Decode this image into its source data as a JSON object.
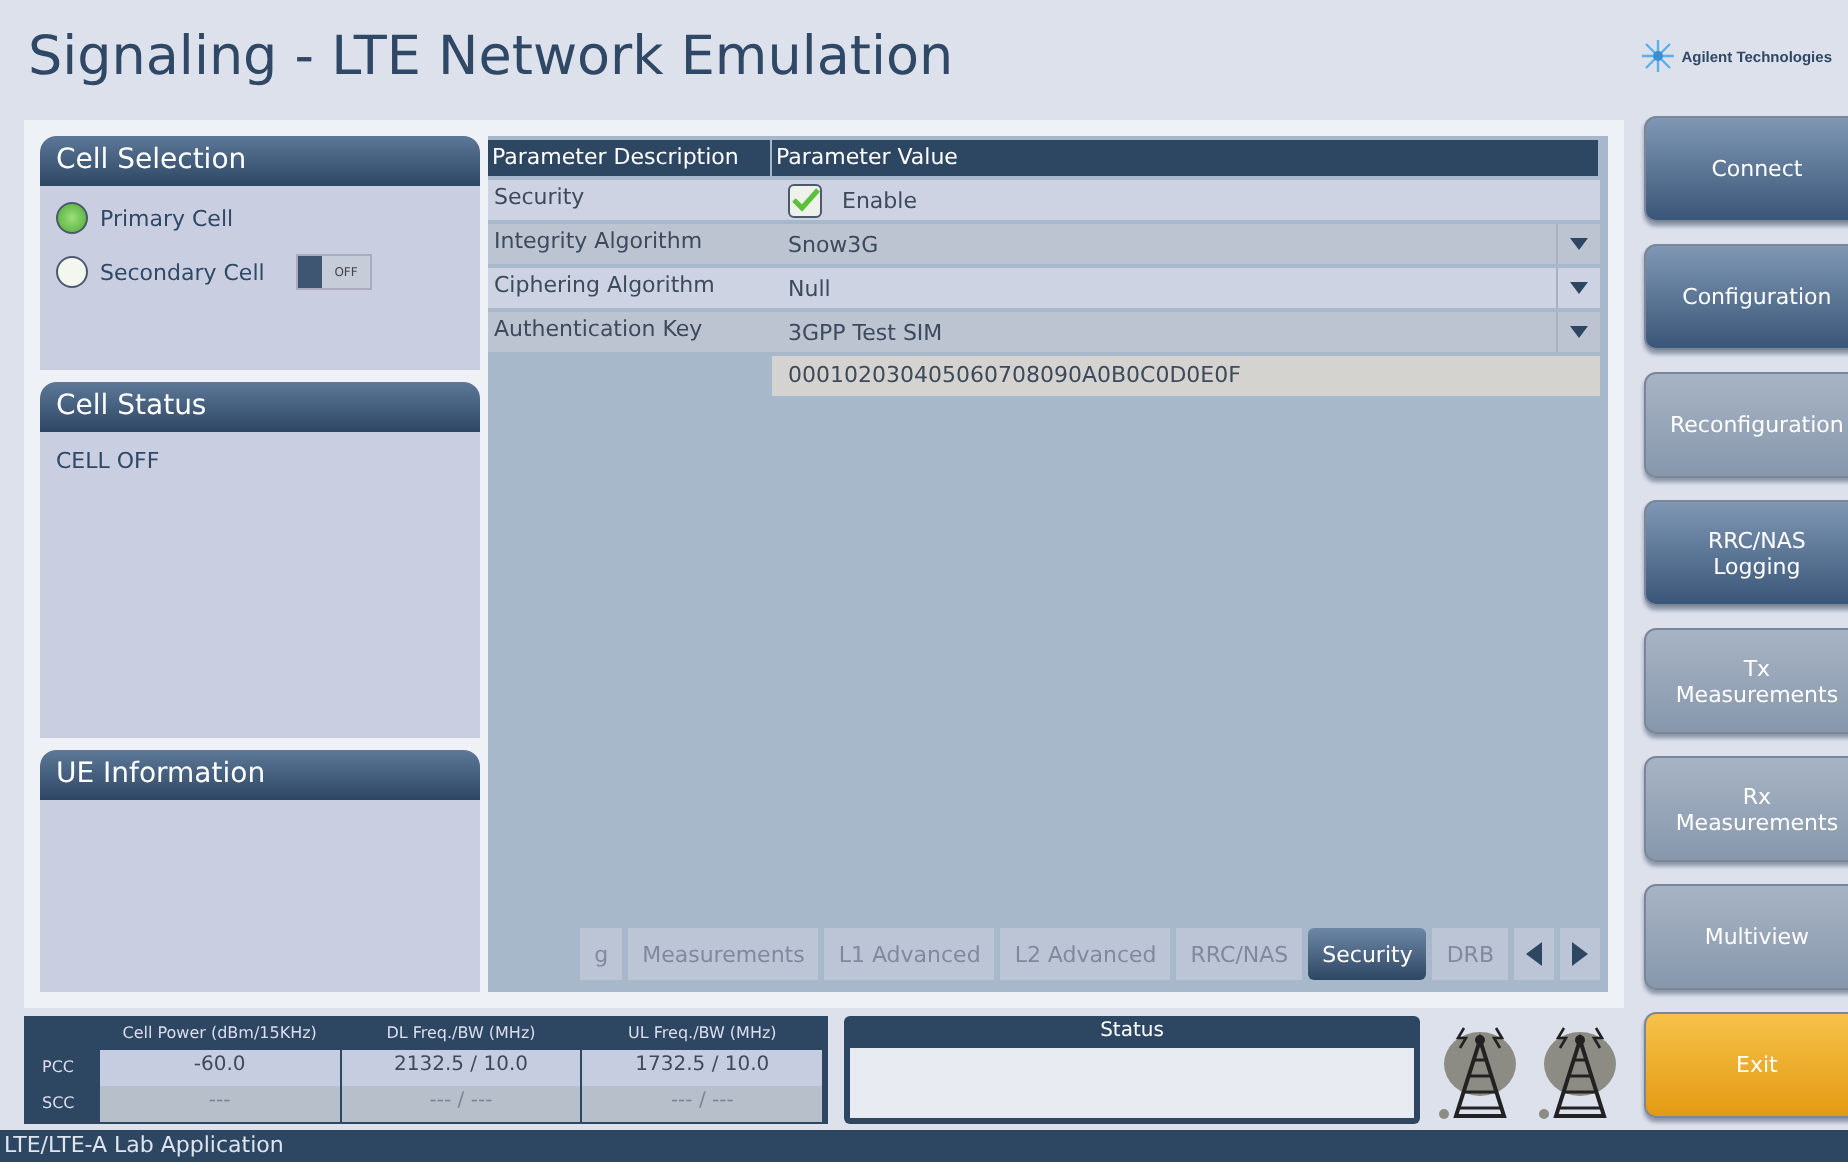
{
  "title": "Signaling - LTE Network Emulation",
  "logo": {
    "text": "Agilent Technologies"
  },
  "cell_selection": {
    "title": "Cell Selection",
    "options": [
      {
        "label": "Primary Cell",
        "selected": true
      },
      {
        "label": "Secondary Cell",
        "selected": false
      }
    ],
    "secondary_toggle": {
      "label": "OFF",
      "on": false
    }
  },
  "cell_status": {
    "title": "Cell Status",
    "text": "CELL OFF"
  },
  "ue_information": {
    "title": "UE Information"
  },
  "parameters": {
    "columns": [
      "Parameter Description",
      "Parameter Value"
    ],
    "rows": [
      {
        "kind": "checkbox",
        "label": "Security",
        "value": "Enable",
        "checked": true
      },
      {
        "kind": "dropdown",
        "label": "Integrity Algorithm",
        "value": "Snow3G"
      },
      {
        "kind": "dropdown",
        "label": "Ciphering Algorithm",
        "value": "Null"
      },
      {
        "kind": "dropdown",
        "label": "Authentication Key",
        "value": "3GPP Test SIM"
      },
      {
        "kind": "text",
        "label": "",
        "value": "000102030405060708090A0B0C0D0E0F"
      }
    ]
  },
  "tabs": [
    {
      "label": "g",
      "selected": false
    },
    {
      "label": "Measurements",
      "selected": false
    },
    {
      "label": "L1 Advanced",
      "selected": false
    },
    {
      "label": "L2 Advanced",
      "selected": false
    },
    {
      "label": "RRC/NAS",
      "selected": false
    },
    {
      "label": "Security",
      "selected": true
    },
    {
      "label": "DRB",
      "selected": false
    }
  ],
  "power_table": {
    "columns": [
      "Cell Power (dBm/15KHz)",
      "DL Freq./BW (MHz)",
      "UL Freq./BW (MHz)"
    ],
    "rows": [
      {
        "label": "PCC",
        "cells": [
          "-60.0",
          "2132.5 / 10.0",
          "1732.5 / 10.0"
        ]
      },
      {
        "label": "SCC",
        "cells": [
          "---",
          "--- / ---",
          "--- / ---"
        ]
      }
    ]
  },
  "status": {
    "title": "Status"
  },
  "buttons": [
    {
      "kind": "normal",
      "label": "Connect",
      "disabled": false
    },
    {
      "kind": "normal",
      "label": "Configuration",
      "disabled": false
    },
    {
      "kind": "normal",
      "label": "Reconfiguration",
      "disabled": true
    },
    {
      "kind": "normal",
      "label": "RRC/NAS Logging",
      "disabled": false
    },
    {
      "kind": "normal",
      "label": "Tx Measurements",
      "disabled": true
    },
    {
      "kind": "normal",
      "label": "Rx Measurements",
      "disabled": true
    },
    {
      "kind": "normal",
      "label": "Multiview",
      "disabled": true
    },
    {
      "kind": "exit",
      "label": "Exit"
    }
  ],
  "footer": "LTE/LTE-A Lab Application"
}
